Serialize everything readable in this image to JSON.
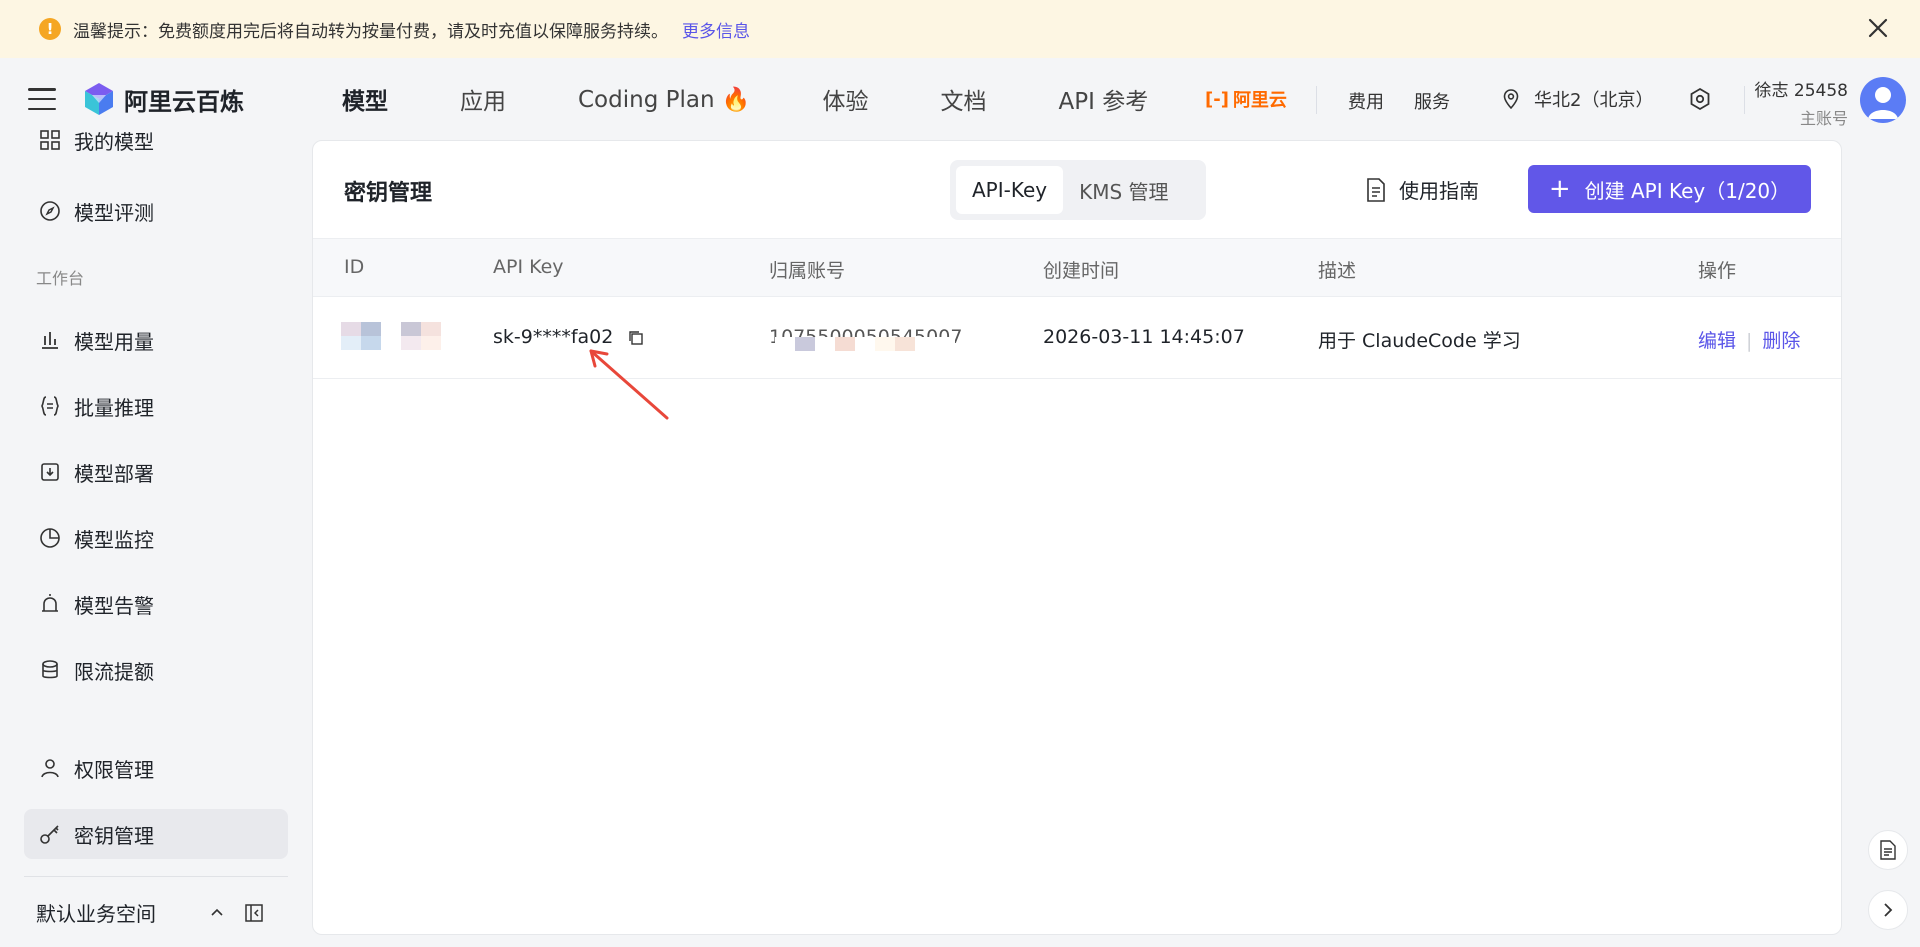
{
  "notice": {
    "text": "温馨提示：免费额度用完后将自动转为按量付费，请及时充值以保障服务持续。",
    "link": "更多信息"
  },
  "header": {
    "logo_text": "阿里云百炼",
    "nav": [
      "模型",
      "应用",
      "Coding Plan",
      "体验",
      "文档",
      "API 参考"
    ],
    "aliyun_label": "阿里云",
    "fees": "费用",
    "service": "服务",
    "region": "华北2（北京）",
    "user_name": "徐志 25458",
    "user_role": "主账号"
  },
  "sidebar": {
    "items_top": [
      {
        "label": "我的模型",
        "icon": "grid-icon"
      },
      {
        "label": "模型评测",
        "icon": "compass-icon"
      }
    ],
    "section_label": "工作台",
    "items_workbench": [
      {
        "label": "模型用量",
        "icon": "bar-chart-icon"
      },
      {
        "label": "批量推理",
        "icon": "braces-icon"
      },
      {
        "label": "模型部署",
        "icon": "download-box-icon"
      },
      {
        "label": "模型监控",
        "icon": "pie-chart-icon"
      },
      {
        "label": "模型告警",
        "icon": "alarm-icon"
      },
      {
        "label": "限流提额",
        "icon": "database-icon"
      }
    ],
    "items_bottom": [
      {
        "label": "权限管理",
        "icon": "user-icon"
      },
      {
        "label": "密钥管理",
        "icon": "key-icon"
      }
    ],
    "workspace": "默认业务空间"
  },
  "main": {
    "title": "密钥管理",
    "tabs": [
      "API-Key",
      "KMS 管理"
    ],
    "guide": "使用指南",
    "create_button": "创建 API Key（1/20）",
    "columns": [
      "ID",
      "API Key",
      "归属账号",
      "创建时间",
      "描述",
      "操作"
    ],
    "rows": [
      {
        "api_key": "sk-9****fa02",
        "account": "1075500050545007",
        "created": "2026-03-11 14:45:07",
        "description": "用于 ClaudeCode 学习",
        "edit": "编辑",
        "delete": "删除"
      }
    ]
  },
  "colors": {
    "accent": "#6157e8",
    "link": "#5a55e8",
    "brand_orange": "#ff6a00",
    "notice_bg": "#fdf6e3",
    "annotation_arrow": "#e8473a"
  }
}
